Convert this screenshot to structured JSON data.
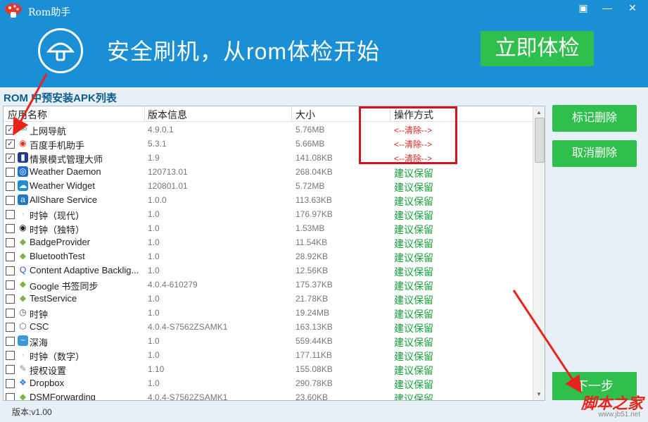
{
  "window": {
    "title": "Rom助手",
    "restore_icon": "restore-icon",
    "minimize_icon": "minimize-icon",
    "close_icon": "close-icon"
  },
  "banner": {
    "slogan": "安全刷机，从rom体检开始",
    "check_button": "立即体检",
    "logo_icon": "mushroom-icon"
  },
  "section_title": "ROM 中预安装APK列表",
  "columns": {
    "name": "应用名称",
    "version": "版本信息",
    "size": "大小",
    "action": "操作方式"
  },
  "rows": [
    {
      "checked": true,
      "name": "上网导航",
      "version": "4.9.0.1",
      "size": "5.76MB",
      "action": "<--清除-->",
      "action_type": "delete",
      "icon": "hao123-icon"
    },
    {
      "checked": true,
      "name": "百度手机助手",
      "version": "5.3.1",
      "size": "5.66MB",
      "action": "<--清除-->",
      "action_type": "delete",
      "icon": "baidu-assistant-icon"
    },
    {
      "checked": true,
      "name": "情景模式管理大师",
      "version": "1.9",
      "size": "141.08KB",
      "action": "<--清除-->",
      "action_type": "delete",
      "icon": "phone-icon"
    },
    {
      "checked": false,
      "name": "Weather Daemon",
      "version": "120713.01",
      "size": "268.04KB",
      "action": "建议保留",
      "action_type": "keep",
      "icon": "weather-icon"
    },
    {
      "checked": false,
      "name": "Weather Widget",
      "version": "120801.01",
      "size": "5.72MB",
      "action": "建议保留",
      "action_type": "keep",
      "icon": "weather-widget-icon"
    },
    {
      "checked": false,
      "name": "AllShare Service",
      "version": "1.0.0",
      "size": "113.63KB",
      "action": "建议保留",
      "action_type": "keep",
      "icon": "allshare-icon"
    },
    {
      "checked": false,
      "name": "时钟（现代）",
      "version": "1.0",
      "size": "176.97KB",
      "action": "建议保留",
      "action_type": "keep",
      "icon": "clock-modern-icon"
    },
    {
      "checked": false,
      "name": "时钟（独特）",
      "version": "1.0",
      "size": "1.53MB",
      "action": "建议保留",
      "action_type": "keep",
      "icon": "clock-unique-icon"
    },
    {
      "checked": false,
      "name": "BadgeProvider",
      "version": "1.0",
      "size": "11.54KB",
      "action": "建议保留",
      "action_type": "keep",
      "icon": "android-icon"
    },
    {
      "checked": false,
      "name": "BluetoothTest",
      "version": "1.0",
      "size": "28.92KB",
      "action": "建议保留",
      "action_type": "keep",
      "icon": "android-icon"
    },
    {
      "checked": false,
      "name": "Content Adaptive Backlig...",
      "version": "1.0",
      "size": "12.56KB",
      "action": "建议保留",
      "action_type": "keep",
      "icon": "backlight-icon"
    },
    {
      "checked": false,
      "name": "Google 书签同步",
      "version": "4.0.4-610279",
      "size": "175.37KB",
      "action": "建议保留",
      "action_type": "keep",
      "icon": "android-icon"
    },
    {
      "checked": false,
      "name": "TestService",
      "version": "1.0",
      "size": "21.78KB",
      "action": "建议保留",
      "action_type": "keep",
      "icon": "android-icon"
    },
    {
      "checked": false,
      "name": "时钟",
      "version": "1.0",
      "size": "19.24MB",
      "action": "建议保留",
      "action_type": "keep",
      "icon": "clock-icon"
    },
    {
      "checked": false,
      "name": "CSC",
      "version": "4.0.4-S7562ZSAMK1",
      "size": "163.13KB",
      "action": "建议保留",
      "action_type": "keep",
      "icon": "csc-icon"
    },
    {
      "checked": false,
      "name": "深海",
      "version": "1.0",
      "size": "559.44KB",
      "action": "建议保留",
      "action_type": "keep",
      "icon": "ocean-icon"
    },
    {
      "checked": false,
      "name": "时钟（数字）",
      "version": "1.0",
      "size": "177.11KB",
      "action": "建议保留",
      "action_type": "keep",
      "icon": "clock-digital-icon"
    },
    {
      "checked": false,
      "name": "授权设置",
      "version": "1.10",
      "size": "155.08KB",
      "action": "建议保留",
      "action_type": "keep",
      "icon": "settings-icon"
    },
    {
      "checked": false,
      "name": "Dropbox",
      "version": "1.0",
      "size": "290.78KB",
      "action": "建议保留",
      "action_type": "keep",
      "icon": "dropbox-icon"
    },
    {
      "checked": false,
      "name": "DSMForwarding",
      "version": "4.0.4-S7562ZSAMK1",
      "size": "23.60KB",
      "action": "建议保留",
      "action_type": "keep",
      "icon": "android-icon"
    }
  ],
  "buttons": {
    "mark_delete": "标记删除",
    "cancel_delete": "取消删除",
    "next": "下一步"
  },
  "footer": {
    "version": "版本:v1.00"
  },
  "watermark": {
    "text": "脚本之家",
    "url": "www.jb51.net"
  },
  "colors": {
    "header_blue": "#1a8fd6",
    "button_green": "#2fbf4c",
    "delete_red": "#e02020",
    "keep_green": "#18a03a"
  }
}
